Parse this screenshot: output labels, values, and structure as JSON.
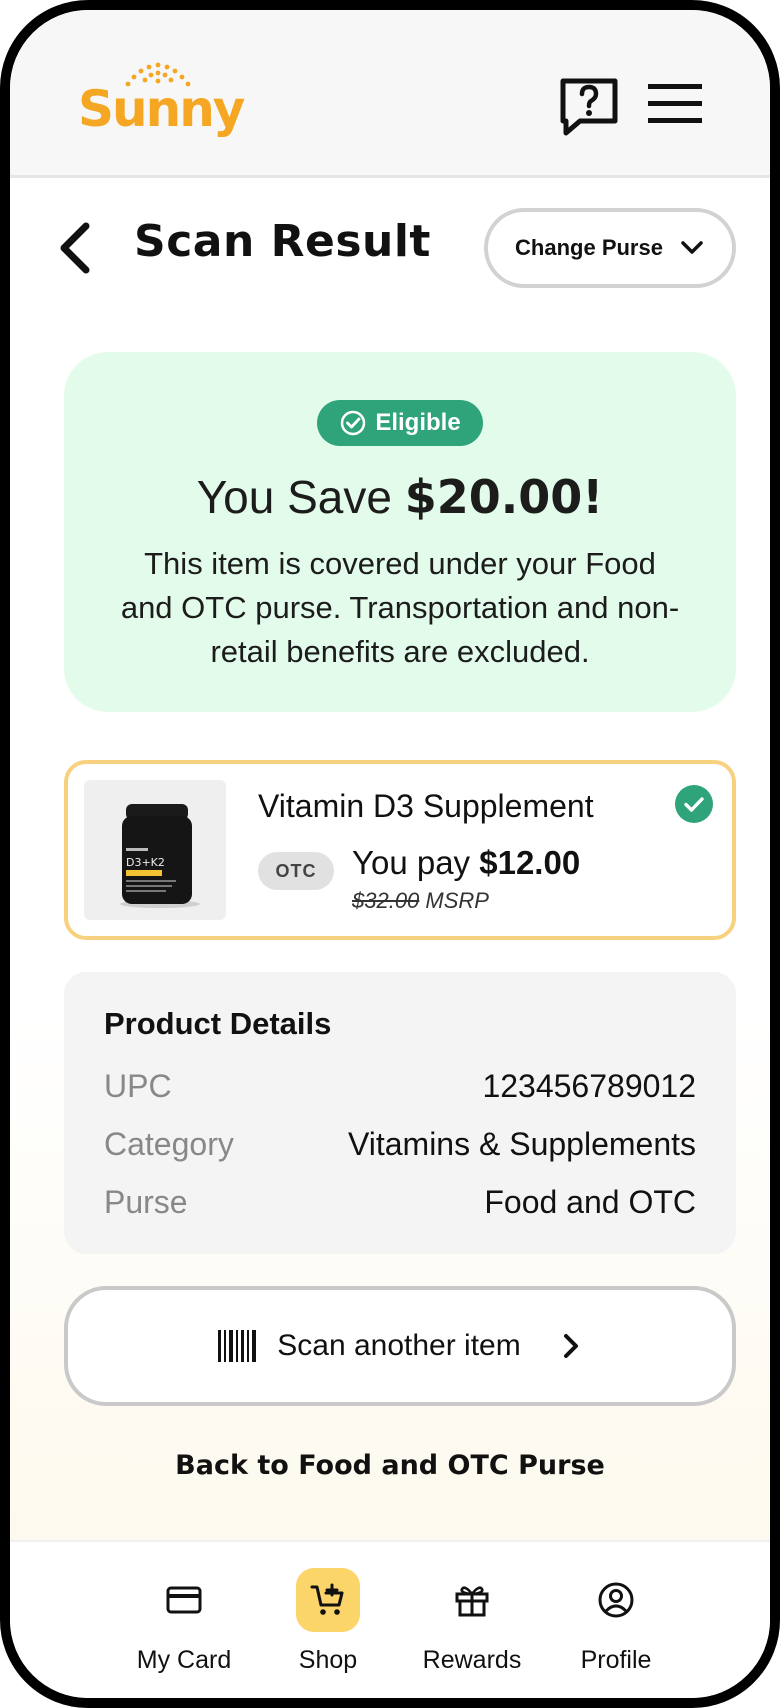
{
  "header": {
    "logo_text": "Sunny",
    "help_icon": "help-chat-icon",
    "menu_icon": "hamburger-menu-icon"
  },
  "title_row": {
    "back_icon": "chevron-left-icon",
    "title": "Scan Result",
    "change_purse_label": "Change Purse"
  },
  "savings": {
    "badge_label": "Eligible",
    "save_prefix": "You Save ",
    "save_amount": "$20.00!",
    "description": "This item is covered under your Food and OTC purse. Transportation and non-retail benefits are excluded."
  },
  "product": {
    "name": "Vitamin D3 Supplement",
    "tag": "OTC",
    "pay_prefix": "You pay ",
    "pay_amount": "$12.00",
    "msrp_price": "$32.00",
    "msrp_label": " MSRP"
  },
  "details": {
    "title": "Product Details",
    "rows": [
      {
        "key": "UPC",
        "value": "123456789012"
      },
      {
        "key": "Category",
        "value": "Vitamins & Supplements"
      },
      {
        "key": "Purse",
        "value": "Food and OTC"
      }
    ]
  },
  "actions": {
    "scan_label": "Scan another item",
    "back_link": "Back to Food and OTC Purse"
  },
  "nav": {
    "items": [
      {
        "label": "My Card",
        "icon": "card-icon"
      },
      {
        "label": "Shop",
        "icon": "cart-icon"
      },
      {
        "label": "Rewards",
        "icon": "gift-icon"
      },
      {
        "label": "Profile",
        "icon": "profile-icon"
      }
    ],
    "active": "Shop"
  },
  "colors": {
    "brand": "#f5a623",
    "eligible_green": "#2fa37a",
    "savings_bg": "#e2fbea",
    "product_border": "#f7d17d",
    "nav_active": "#fbd46a"
  }
}
